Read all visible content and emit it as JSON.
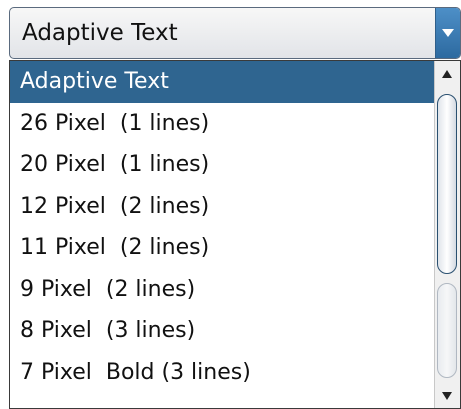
{
  "combo": {
    "selected_label": "Adaptive Text"
  },
  "dropdown": {
    "options": [
      "Adaptive Text",
      "26 Pixel  (1 lines)",
      "20 Pixel  (1 lines)",
      "12 Pixel  (2 lines)",
      "11 Pixel  (2 lines)",
      "9 Pixel  (2 lines)",
      "8 Pixel  (3 lines)",
      "7 Pixel  Bold (3 lines)"
    ],
    "highlighted_index": 0
  },
  "colors": {
    "highlight": "#2f6590",
    "arrow_button": "#3a7bb4"
  },
  "icons": {
    "dropdown": "chevron-down-icon",
    "scroll_up": "scroll-up-arrow-icon",
    "scroll_down": "scroll-down-arrow-icon"
  }
}
